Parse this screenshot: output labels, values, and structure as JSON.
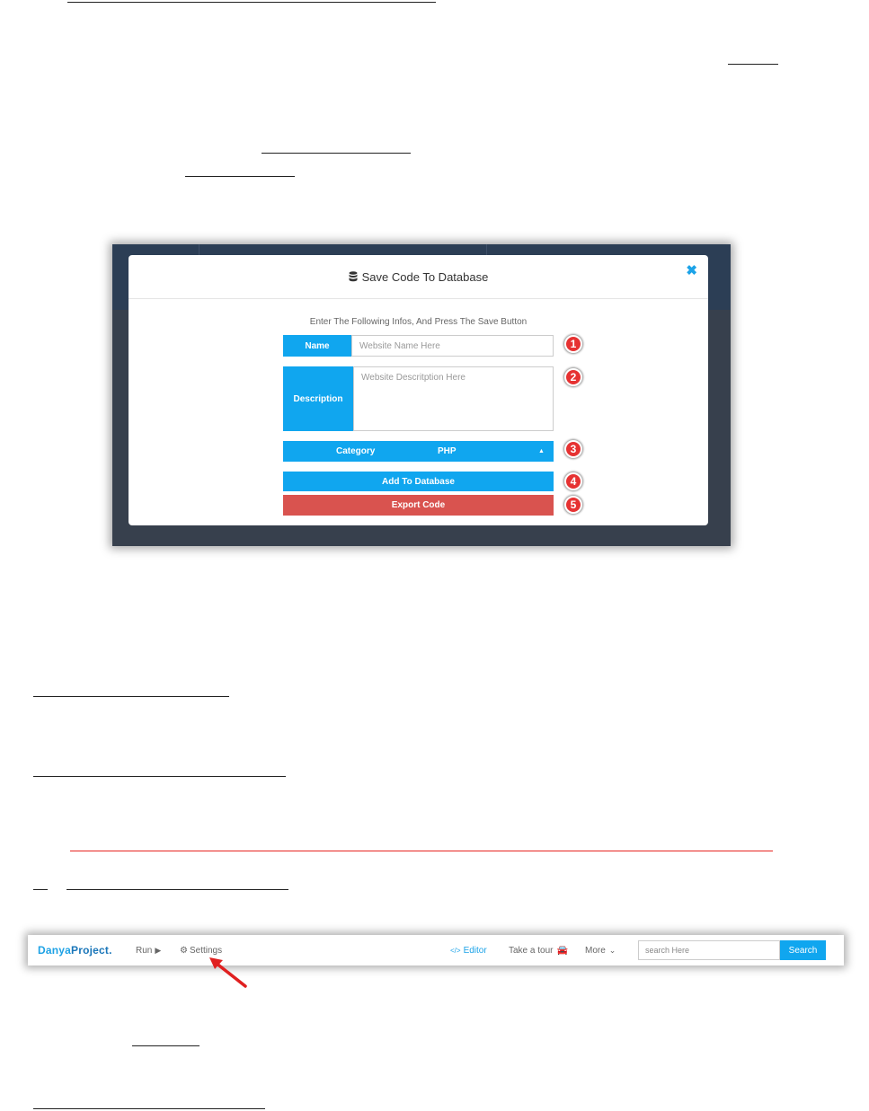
{
  "modal": {
    "title": "Save Code To Database",
    "close_icon": "close-icon",
    "intro": "Enter The Following Infos, And Press The Save Button",
    "name_label": "Name",
    "name_placeholder": "Website Name Here",
    "description_label": "Description",
    "description_placeholder": "Website Descritption Here",
    "category_label": "Category",
    "category_value": "PHP",
    "add_button": "Add To Database",
    "export_button": "Export Code",
    "badges": [
      "1",
      "2",
      "3",
      "4",
      "5"
    ],
    "colors": {
      "accent": "#10a6ef",
      "danger": "#d9534f",
      "badge": "#e63232"
    }
  },
  "navbar": {
    "brand_part1": "Danya",
    "brand_part2": "Project.",
    "run": "Run",
    "settings": "Settings",
    "editor": "Editor",
    "tour": "Take a tour",
    "more": "More",
    "search_placeholder": "search Here",
    "search_button": "Search"
  }
}
